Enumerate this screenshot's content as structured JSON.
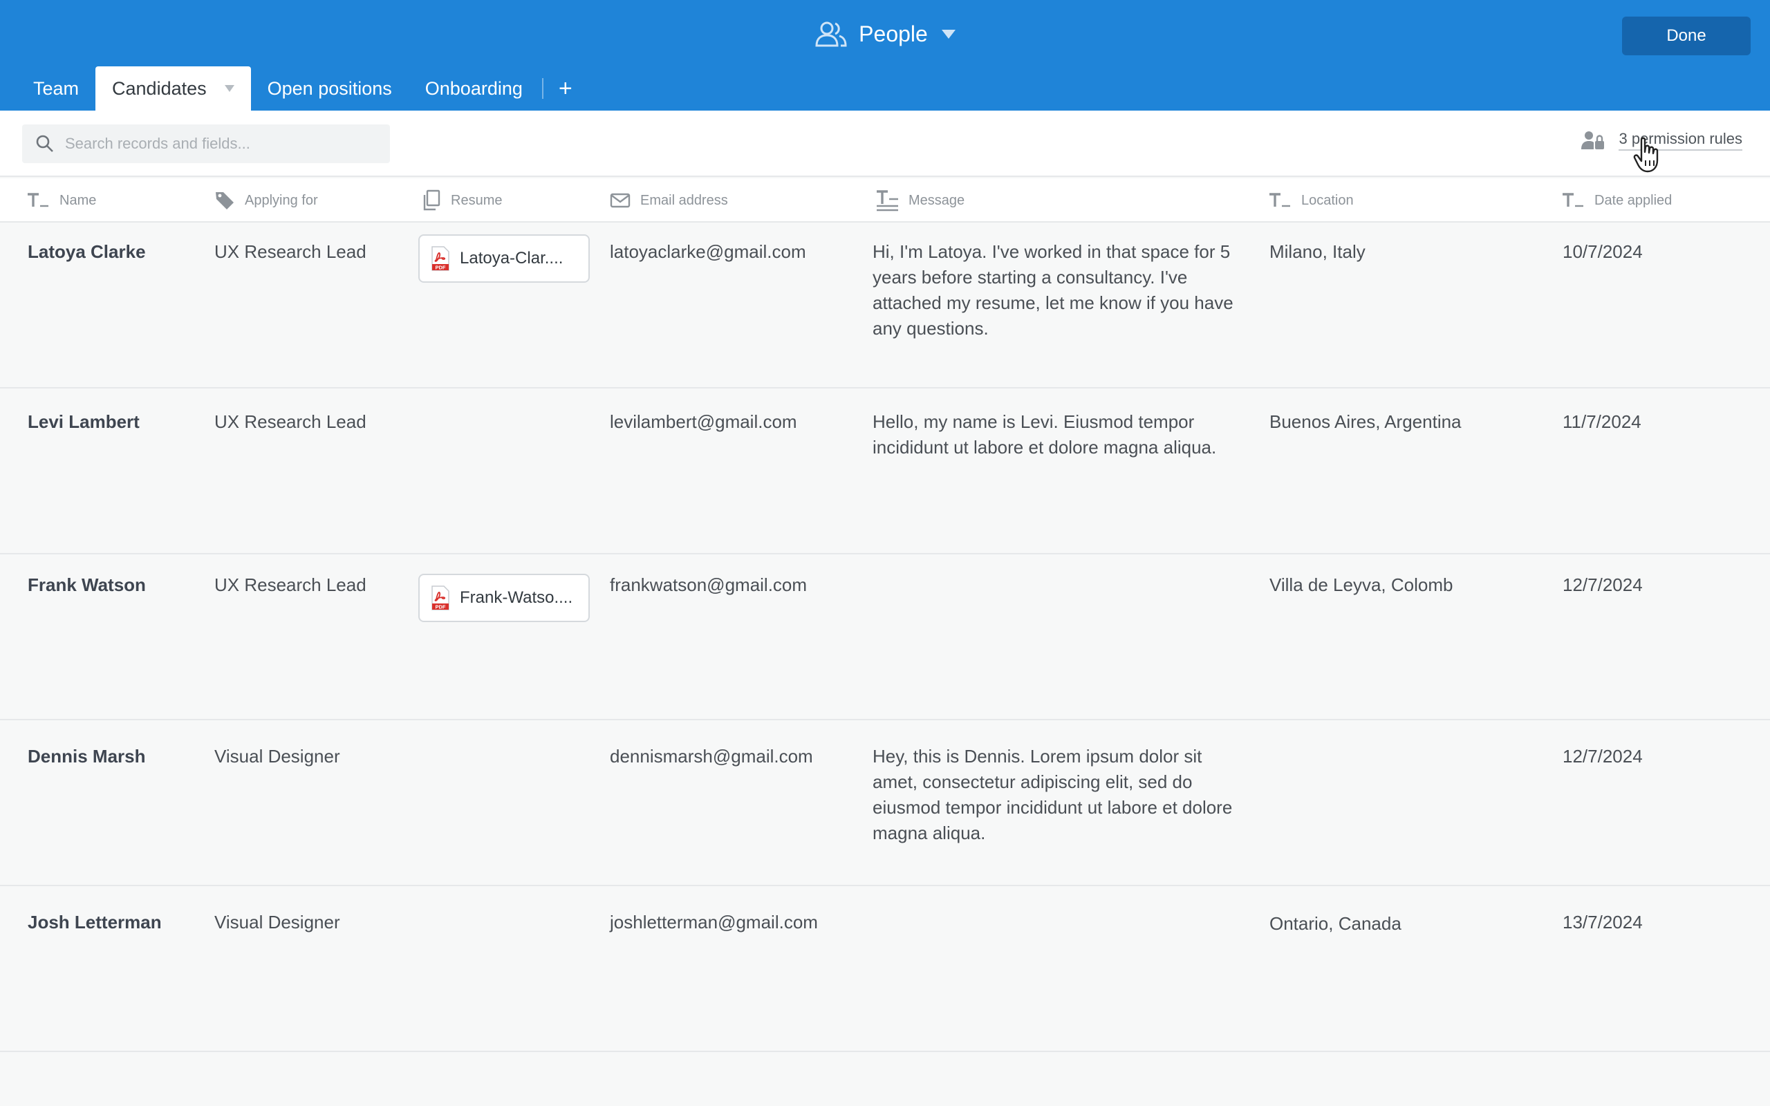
{
  "header": {
    "app_title": "People",
    "done_label": "Done",
    "icons": {
      "title": "people-icon",
      "title_menu": "chevron-down-icon"
    }
  },
  "tabs": [
    {
      "label": "Team",
      "active": false
    },
    {
      "label": "Candidates",
      "active": true
    },
    {
      "label": "Open positions",
      "active": false
    },
    {
      "label": "Onboarding",
      "active": false
    }
  ],
  "add_tab_label": "+",
  "toolbar": {
    "search_placeholder": "Search records and fields...",
    "permission_rules": "3 permission rules"
  },
  "columns": [
    {
      "label": "Name",
      "icon": "text-field-icon"
    },
    {
      "label": "Applying for",
      "icon": "tag-icon"
    },
    {
      "label": "Resume",
      "icon": "attachment-icon"
    },
    {
      "label": "Email address",
      "icon": "email-icon"
    },
    {
      "label": "Message",
      "icon": "long-text-icon"
    },
    {
      "label": "Location",
      "icon": "text-field-icon"
    },
    {
      "label": "Date applied",
      "icon": "text-field-icon"
    }
  ],
  "rows": [
    {
      "name": "Latoya Clarke",
      "applying_for": "UX Research Lead",
      "resume": "Latoya-Clar....",
      "email": "latoyaclarke@gmail.com",
      "message": "Hi, I'm Latoya. I've worked in that space for 5 years before starting a consultancy. I've attached my resume, let me know if you have any questions.",
      "location": "Milano, Italy",
      "date": "10/7/2024"
    },
    {
      "name": "Levi Lambert",
      "applying_for": "UX Research Lead",
      "resume": "",
      "email": "levilambert@gmail.com",
      "message": "Hello, my name is Levi. Eiusmod tempor incididunt ut labore et dolore magna aliqua.",
      "location": "Buenos Aires, Argentina",
      "date": "11/7/2024"
    },
    {
      "name": "Frank Watson",
      "applying_for": "UX Research Lead",
      "resume": "Frank-Watso....",
      "email": "frankwatson@gmail.com",
      "message": "",
      "location": "Villa de Leyva, Colomb",
      "date": "12/7/2024"
    },
    {
      "name": "Dennis Marsh",
      "applying_for": "Visual Designer",
      "resume": "",
      "email": "dennismarsh@gmail.com",
      "message": "Hey, this is Dennis. Lorem ipsum dolor sit amet, consectetur adipiscing elit, sed do eiusmod tempor incididunt ut labore et dolore magna aliqua.",
      "location": "",
      "date": "12/7/2024"
    },
    {
      "name": "Josh Letterman",
      "applying_for": "Visual Designer",
      "resume": "",
      "email": "joshletterman@gmail.com",
      "message": "",
      "location": "Ontario, Canada",
      "date": "13/7/2024"
    }
  ],
  "colors": {
    "topbar": "#1f84d8",
    "done_button": "#1565ad",
    "pdf_red": "#d9302c"
  }
}
